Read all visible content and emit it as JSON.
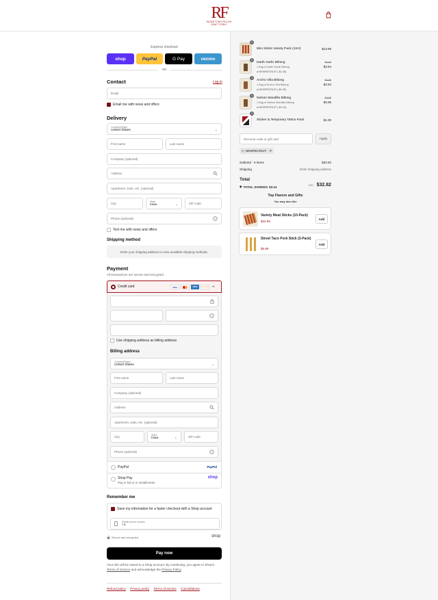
{
  "brand": {
    "monogram": "RF",
    "name_line1": "RASSETTING FELLER",
    "name_line2": "CRAFT JERKY"
  },
  "express": {
    "title": "Express checkout",
    "shop": "shop",
    "paypal": "PayPal",
    "gpay": "G Pay",
    "venmo": "venmo",
    "or": "OR"
  },
  "contact": {
    "title": "Contact",
    "login": "Log in",
    "email_placeholder": "Email",
    "news_label": "Email me with news and offers"
  },
  "delivery": {
    "title": "Delivery",
    "country_label": "Country/Region",
    "country": "United States",
    "first_name": "First name",
    "last_name": "Last name",
    "company": "Company (optional)",
    "address": "Address",
    "apartment": "Apartment, suite, etc. (optional)",
    "city": "City",
    "state_label": "State",
    "state": "Iowa",
    "zip": "ZIP code",
    "phone": "Phone (optional)",
    "text_label": "Text me with news and offers"
  },
  "shipping": {
    "title": "Shipping method",
    "message": "Enter your shipping address to view available shipping methods."
  },
  "payment": {
    "title": "Payment",
    "subtitle": "All transactions are secure and encrypted.",
    "credit_card": "Credit card",
    "card_logos": [
      "VISA",
      "MC",
      "AMEX",
      "DISCOVER",
      "+5"
    ],
    "same_address": "Use shipping address as billing address",
    "paypal": "PayPal",
    "paypal_logo": "PayPal",
    "shoppay": "Shop Pay",
    "shoppay_sub": "Pay in full or in installments",
    "shoppay_logo": "shop"
  },
  "billing": {
    "title": "Billing address",
    "country_label": "Country/Region",
    "country": "United States",
    "first_name": "First name",
    "last_name": "Last name",
    "company": "Company (optional)",
    "address": "Address",
    "apartment": "Apartment, suite, etc. (optional)",
    "city": "City",
    "state_label": "State",
    "state": "Iowa",
    "zip": "ZIP code",
    "phone": "Phone (optional)"
  },
  "remember": {
    "title": "Remember me",
    "save_label": "Save my information for a faster checkout with a Shop account",
    "mobile_label": "Mobile phone number",
    "mobile_value": "+1",
    "secure": "Secure and encrypted",
    "shop": "shop"
  },
  "pay_now": "Pay now",
  "disclaimer": {
    "text1": "Your info will be saved to a Shop account. By continuing, you agree to Shop's",
    "tos": "Terms of Service",
    "text2": "and acknowledge the",
    "privacy": "Privacy Policy",
    "text3": "."
  },
  "footer": [
    "Refund policy",
    "Privacy policy",
    "Terms of service",
    "Cancellations"
  ],
  "cart": {
    "items": [
      {
        "name": "Mini Sticks Variety Pack (12ct)",
        "qty": "1",
        "price": "$13.99",
        "orig": "",
        "variant": "",
        "discount": ""
      },
      {
        "name": "Darth Garlic Biltong",
        "qty": "1",
        "price": "$3.94",
        "orig": "$5.99",
        "variant": "1 Bag of Darth Garlic Biltong",
        "discount": "NEWRECRUIT (-$1.05)"
      },
      {
        "name": "Ancho Villa Biltong",
        "qty": "1",
        "price": "$3.94",
        "orig": "$5.99",
        "variant": "1 Bag of Ancho Villa Biltong",
        "discount": "NEWRECRUIT (-$1.05)"
      },
      {
        "name": "Nelson Mandilla Biltong",
        "qty": "1",
        "price": "$3.95",
        "orig": "$5.99",
        "variant": "1 Bag of Nelson Mandilla Biltong",
        "discount": "NEWRECRUIT (-$1.04)"
      },
      {
        "name": "Sticker & Temporary Tattoo Pack",
        "qty": "1",
        "price": "$1.00",
        "orig": "",
        "variant": "",
        "discount": ""
      }
    ],
    "discount_placeholder": "Discount code or gift card",
    "apply": "Apply",
    "code": "NEWRECRUIT",
    "subtotal_label": "Subtotal · 5 items",
    "subtotal": "$32.82",
    "shipping_label": "Shipping",
    "shipping_value": "Enter shipping address",
    "total_label": "Total",
    "currency": "USD",
    "total": "$32.82",
    "savings_label": "TOTAL SAVINGS",
    "savings": "$3.14"
  },
  "upsell": {
    "title": "Top Flavors and Gifts",
    "subtitle": "You may also like",
    "items": [
      {
        "name": "Variety Meat Sticks (10-Pack)",
        "price": "$22.99",
        "add": "Add"
      },
      {
        "name": "Street Taco Pork Stick (3-Pack)",
        "price": "$5.99",
        "add": "Add"
      }
    ]
  }
}
